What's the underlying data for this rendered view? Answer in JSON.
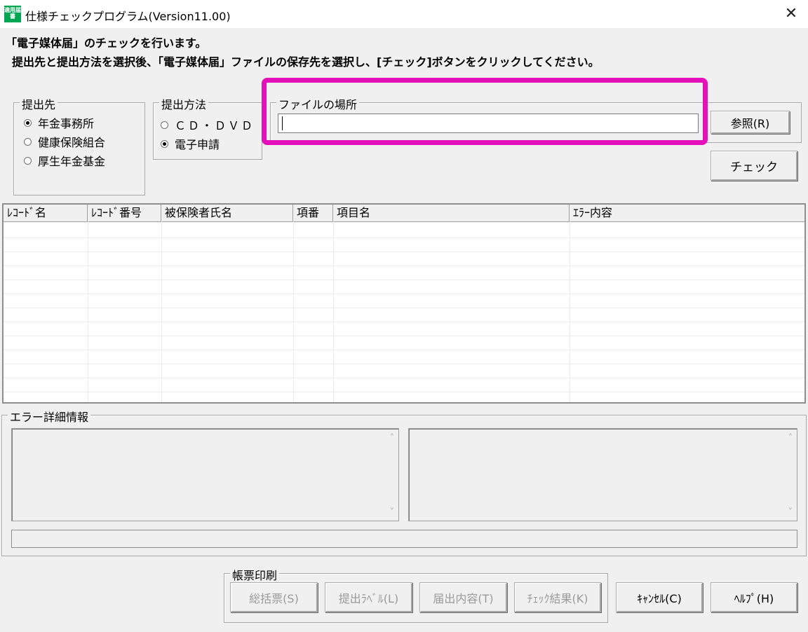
{
  "window": {
    "icon_text": "適用届書",
    "title": "仕様チェックプログラム(Version11.00)",
    "close_glyph": "✕"
  },
  "intro": {
    "line1": "「電子媒体届」のチェックを行います。",
    "line2": "提出先と提出方法を選択後、「電子媒体届」ファイルの保存先を選択し、[チェック]ボタンをクリックしてください。"
  },
  "destination": {
    "legend": "提出先",
    "options": [
      {
        "label": "年金事務所",
        "selected": true
      },
      {
        "label": "健康保険組合",
        "selected": false
      },
      {
        "label": "厚生年金基金",
        "selected": false
      }
    ]
  },
  "method": {
    "legend": "提出方法",
    "options": [
      {
        "label": "ＣＤ・ＤＶＤ",
        "selected": false
      },
      {
        "label": "電子申請",
        "selected": true
      }
    ]
  },
  "file_location": {
    "legend": "ファイルの場所",
    "value": "",
    "browse_label": "参照(R)"
  },
  "check_button": "チェック",
  "grid": {
    "columns": [
      "ﾚｺｰﾄﾞ名",
      "ﾚｺｰﾄﾞ番号",
      "被保険者氏名",
      "項番",
      "項目名",
      "ｴﾗｰ内容"
    ],
    "rows": []
  },
  "error_detail": {
    "legend": "エラー詳細情報",
    "status_text": ""
  },
  "print_group": {
    "legend": "帳票印刷",
    "buttons": [
      "総括票(S)",
      "提出ﾗﾍﾞﾙ(L)",
      "届出内容(T)",
      "ﾁｪｯｸ結果(K)"
    ]
  },
  "cancel_button": "ｷｬﾝｾﾙ(C)",
  "help_button": "ﾍﾙﾌﾟ(H)",
  "colors": {
    "highlight": "#e410b9",
    "icon_bg": "#00a651"
  }
}
